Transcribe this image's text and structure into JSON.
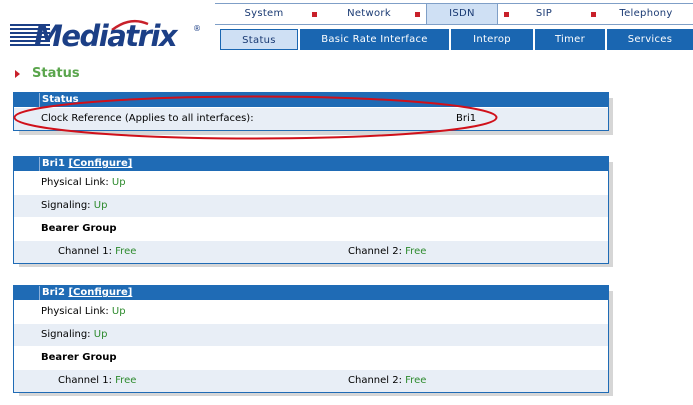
{
  "brand": {
    "name": "Mediatrix",
    "reg": "®"
  },
  "topnav": [
    {
      "label": "System"
    },
    {
      "label": "Network"
    },
    {
      "label": "ISDN",
      "active": true
    },
    {
      "label": "SIP"
    },
    {
      "label": "Telephony"
    }
  ],
  "subnav": [
    {
      "label": "Status",
      "active": true
    },
    {
      "label": "Basic Rate Interface"
    },
    {
      "label": "Interop"
    },
    {
      "label": "Timer"
    },
    {
      "label": "Services"
    }
  ],
  "page": {
    "title": "Status"
  },
  "status_panel": {
    "header": "Status",
    "clock_label": "Clock Reference (Applies to all interfaces):",
    "clock_value": "Bri1"
  },
  "bri1": {
    "name": "Bri1",
    "configure": "[Configure]",
    "physical_link_label": "Physical Link:",
    "physical_link_value": "Up",
    "signaling_label": "Signaling:",
    "signaling_value": "Up",
    "bearer_group": "Bearer Group",
    "channel1_label": "Channel 1:",
    "channel1_value": "Free",
    "channel2_label": "Channel 2:",
    "channel2_value": "Free"
  },
  "bri2": {
    "name": "Bri2",
    "configure": "[Configure]",
    "physical_link_label": "Physical Link:",
    "physical_link_value": "Up",
    "signaling_label": "Signaling:",
    "signaling_value": "Up",
    "bearer_group": "Bearer Group",
    "channel1_label": "Channel 1:",
    "channel1_value": "Free",
    "channel2_label": "Channel 2:",
    "channel2_value": "Free"
  },
  "colors": {
    "nav_blue": "#1a66b1",
    "status_green": "#2e8b2e",
    "title_green": "#5aa54c",
    "accent_red": "#c8202a",
    "annotation_red": "#d0101a"
  }
}
